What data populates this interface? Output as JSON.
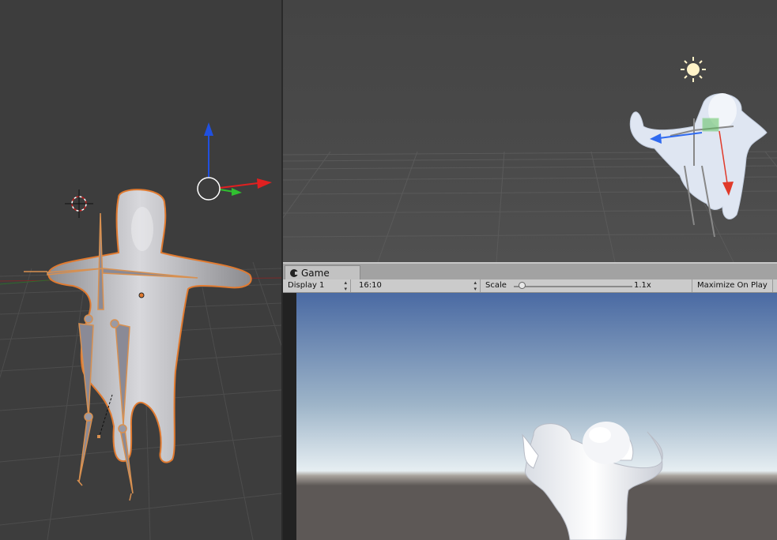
{
  "game_panel": {
    "tab_label": "Game",
    "display_selector": "Display 1",
    "aspect_selector": "16:10",
    "scale_label": "Scale",
    "scale_value": "1.1x",
    "maximize_toggle": "Maximize On Play"
  },
  "icons": {
    "game_tab": "game-controller-icon",
    "sun": "directional-light-icon",
    "cursor": "3d-cursor-icon"
  },
  "colors": {
    "axis_x": "#e02020",
    "axis_y": "#30c030",
    "axis_z": "#2050e0",
    "selection_outline": "#e07a30",
    "sky_top": "#4a6aa3",
    "horizon": "#e6eef2",
    "ground": "#5d5856"
  }
}
